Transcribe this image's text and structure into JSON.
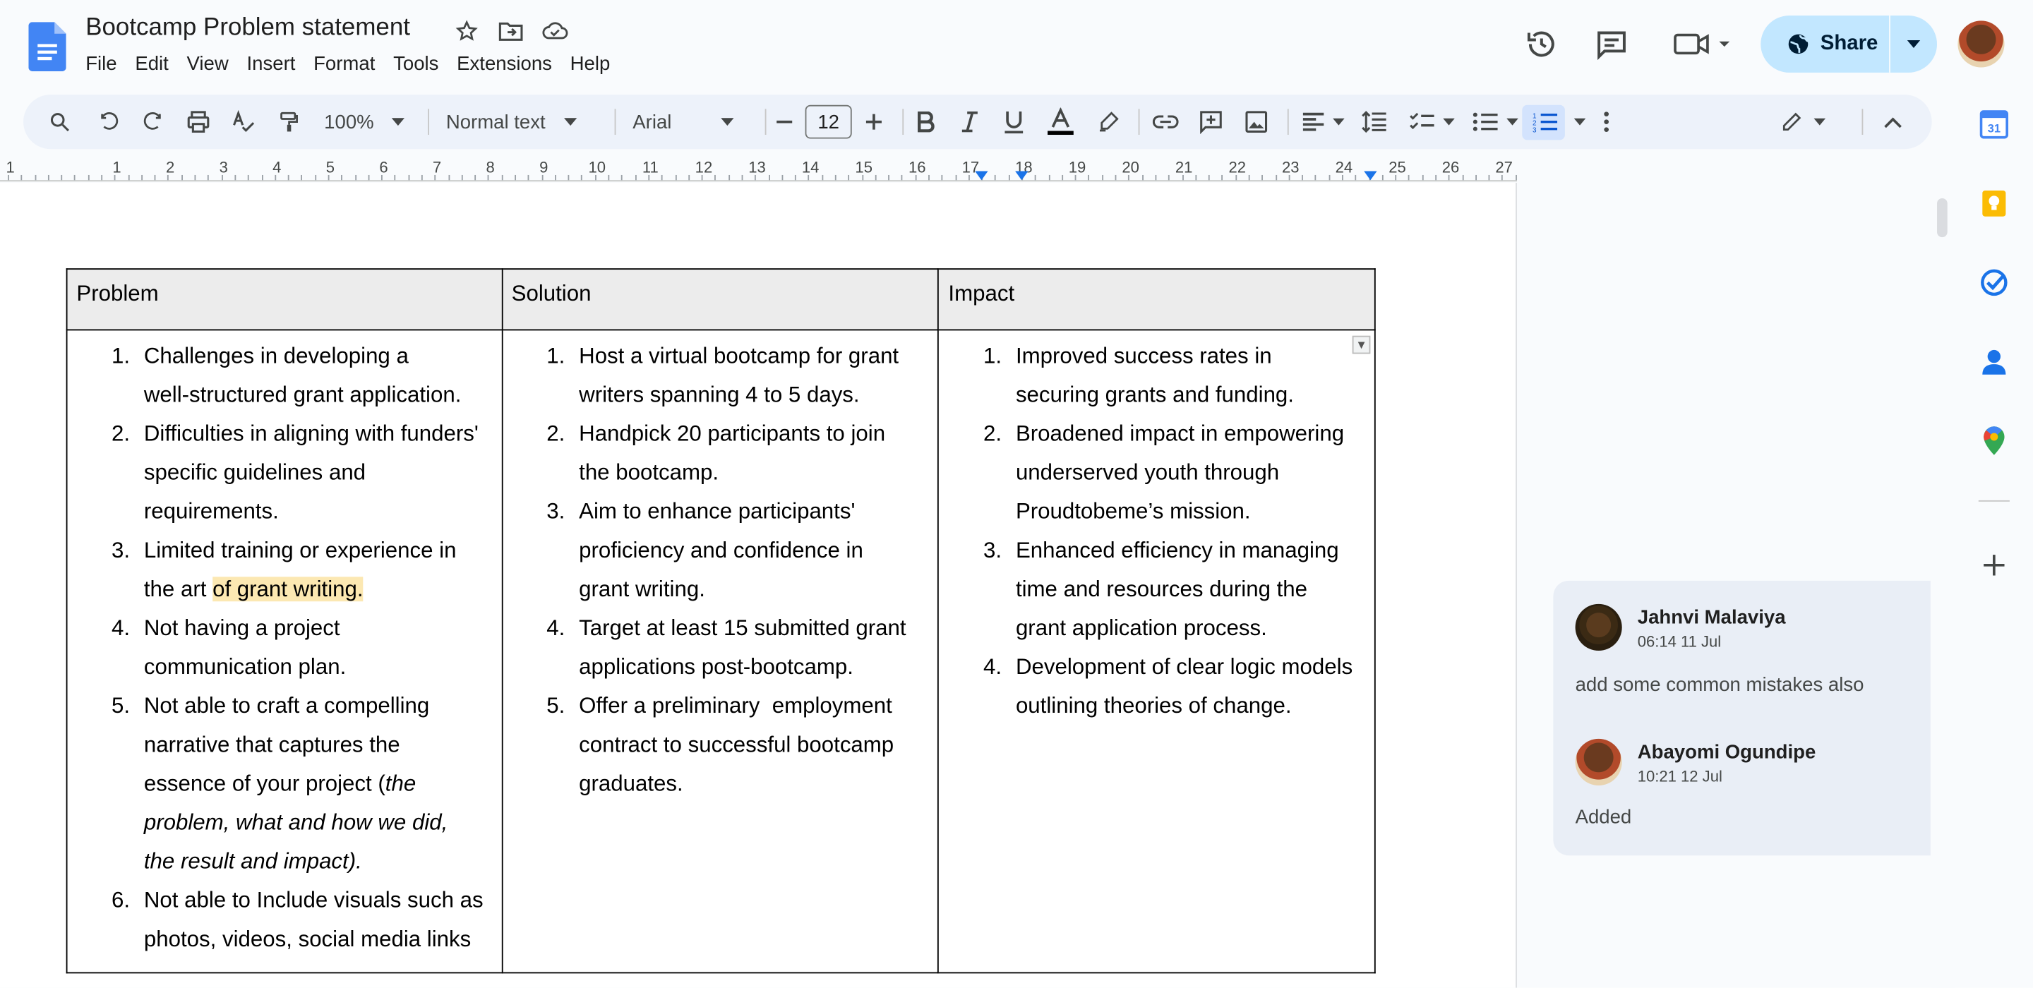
{
  "document": {
    "title": "Bootcamp Problem statement"
  },
  "menu": [
    "File",
    "Edit",
    "View",
    "Insert",
    "Format",
    "Tools",
    "Extensions",
    "Help"
  ],
  "header": {
    "share_label": "Share"
  },
  "toolbar": {
    "zoom": "100%",
    "style": "Normal text",
    "font": "Arial",
    "font_size": "12"
  },
  "ruler": {
    "numbers": [
      "1",
      "1",
      "2",
      "3",
      "4",
      "5",
      "6",
      "7",
      "8",
      "9",
      "10",
      "11",
      "12",
      "13",
      "14",
      "15",
      "16",
      "17",
      "18",
      "19",
      "20",
      "21",
      "22",
      "23",
      "24",
      "25",
      "26",
      "27"
    ]
  },
  "table": {
    "headers": [
      "Problem",
      "Solution",
      "Impact"
    ],
    "problem": [
      {
        "n": "1.",
        "lines": [
          "Challenges in developing a",
          "well-structured grant application."
        ]
      },
      {
        "n": "2.",
        "lines": [
          "Difficulties in aligning with funders'",
          "specific guidelines and",
          "requirements."
        ]
      },
      {
        "n": "3.",
        "lines": [
          "Limited training or experience in"
        ],
        "pre": "the art ",
        "highlight": "of grant writing."
      },
      {
        "n": "4.",
        "lines": [
          "Not having a project",
          "communication plan."
        ]
      },
      {
        "n": "5.",
        "lines": [
          "Not able to craft a compelling",
          "narrative that captures the"
        ],
        "pre2": "essence of your project (",
        "italic1": "the",
        "italic2": "problem, what and how we did,",
        "italic3": "the result and impact)."
      },
      {
        "n": "6.",
        "lines": [
          "Not able to Include visuals such as",
          "photos, videos, social media links"
        ]
      }
    ],
    "solution": [
      {
        "n": "1.",
        "lines": [
          "Host a virtual bootcamp for grant",
          "writers spanning 4 to 5 days."
        ]
      },
      {
        "n": "2.",
        "lines": [
          "Handpick 20 participants to join",
          "the bootcamp."
        ]
      },
      {
        "n": "3.",
        "lines": [
          "Aim to enhance participants'",
          "proficiency and confidence in",
          "grant writing."
        ]
      },
      {
        "n": "4.",
        "lines": [
          "Target at least 15 submitted grant",
          "applications post-bootcamp."
        ]
      },
      {
        "n": "5.",
        "lines": [
          "Offer a preliminary  employment",
          "contract to successful bootcamp",
          "graduates."
        ]
      }
    ],
    "impact": [
      {
        "n": "1.",
        "lines": [
          "Improved success rates in",
          "securing grants and funding."
        ]
      },
      {
        "n": "2.",
        "lines": [
          "Broadened impact in empowering",
          "underserved youth through",
          "Proudtobeme’s mission."
        ]
      },
      {
        "n": "3.",
        "lines": [
          "Enhanced efficiency in managing",
          "time and resources during the",
          "grant application process."
        ]
      },
      {
        "n": "4.",
        "lines": [
          "Development of clear logic models",
          "outlining theories of change."
        ]
      }
    ]
  },
  "comments": [
    {
      "author": "Jahnvi Malaviya",
      "time": "06:14 11 Jul",
      "text": "add some common mistakes also"
    },
    {
      "author": "Abayomi Ogundipe",
      "time": "10:21 12 Jul",
      "text": "Added"
    }
  ],
  "side_panel": {
    "calendar_day": "31"
  },
  "colors": {
    "share_bg": "#c2e7ff",
    "toolbar_bg": "#edf2fa",
    "highlight": "#fce8b2",
    "comment_bg": "#e9eef6"
  }
}
